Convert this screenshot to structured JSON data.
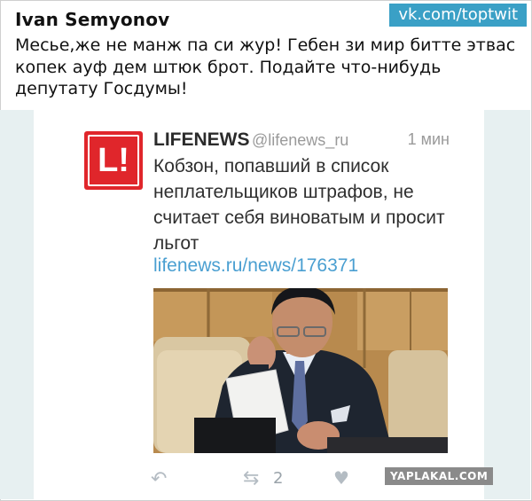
{
  "post": {
    "author": "Ivan Semyonov",
    "source_badge": "vk.com/toptwit",
    "caption": "Месье,же не манж па си жур! Гебен зи мир битте этвас копек ауф дем штюк брот. Подайте что-нибудь депутату Госдумы!"
  },
  "tweet": {
    "logo_text": "L!",
    "account_name": "LIFENEWS",
    "handle": "@lifenews_ru",
    "time": "1 мин",
    "text": "Кобзон, попавший в список неплательщиков штрафов, не считает себя виноватым и просит льгот",
    "link": "lifenews.ru/news/176371",
    "retweet_count": "2",
    "icons": {
      "reply": "reply-icon",
      "retweet": "retweet-icon",
      "like": "heart-icon"
    }
  },
  "watermark": "YAPLAKAL.COM",
  "colors": {
    "badge": "#3aa0c6",
    "logo": "#e0262b",
    "link": "#4a9fd1",
    "tweet_background": "#e7f0f1"
  }
}
